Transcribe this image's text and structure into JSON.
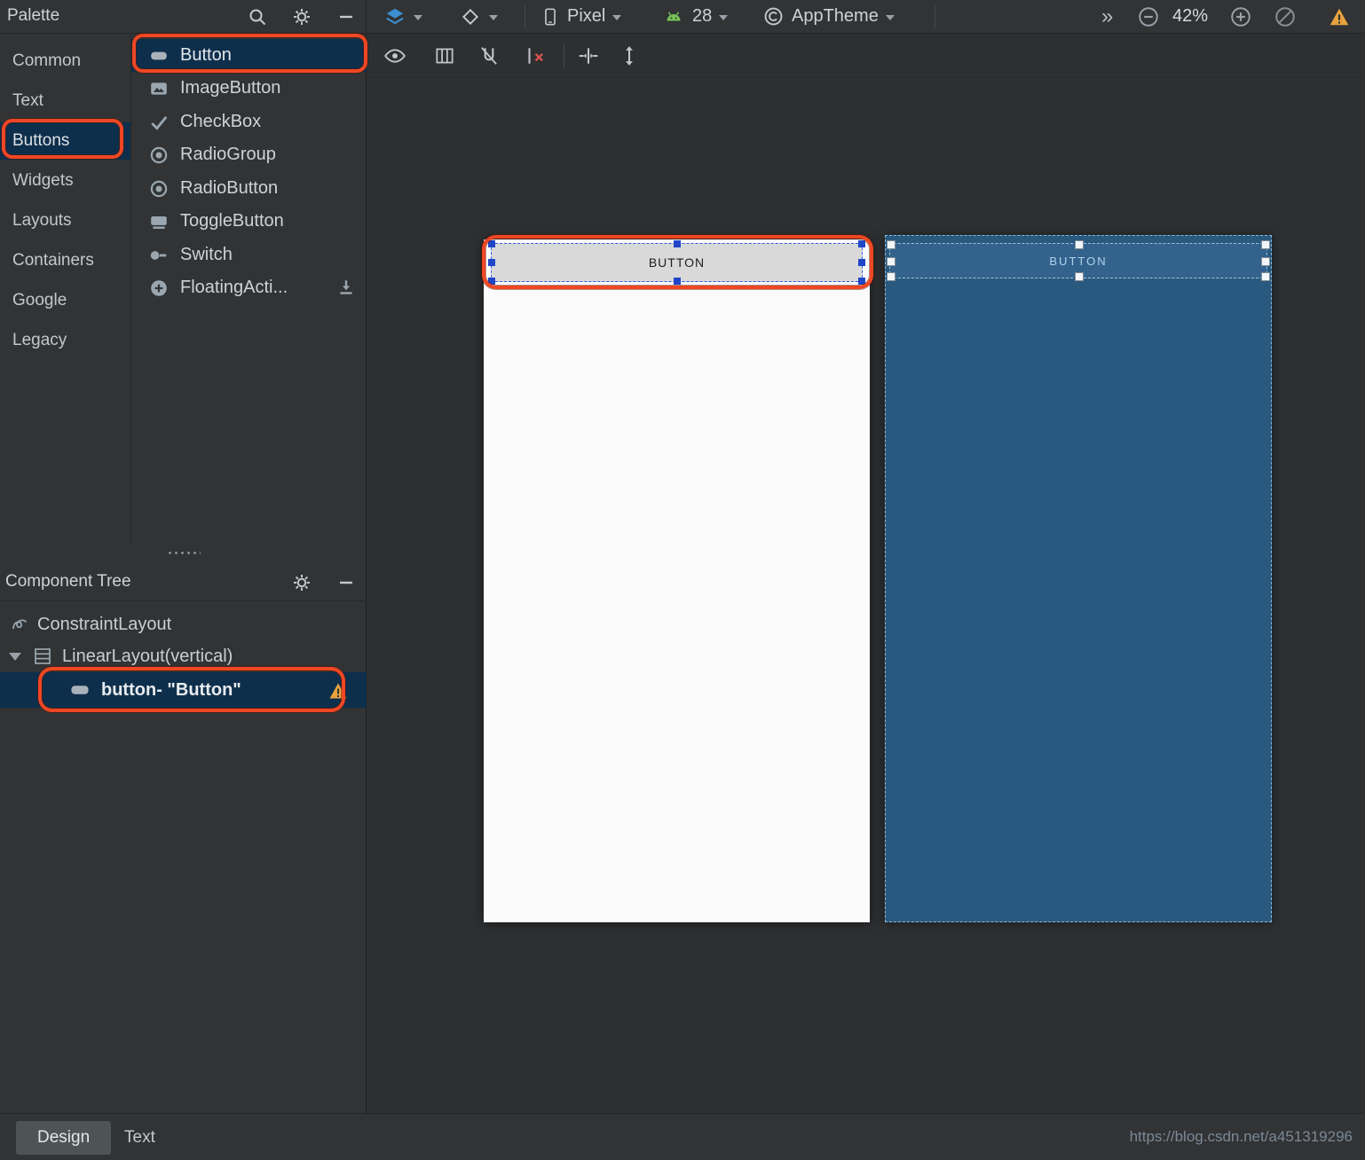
{
  "colors": {
    "annotation_red": "#ee4723",
    "selection_blue": "#0e2f4c",
    "blueprint_blue": "#2a597f",
    "warning_orange": "#e8a33d",
    "android_green": "#78c257"
  },
  "palette": {
    "title": "Palette",
    "categories": [
      {
        "label": "Common",
        "selected": false
      },
      {
        "label": "Text",
        "selected": false
      },
      {
        "label": "Buttons",
        "selected": true
      },
      {
        "label": "Widgets",
        "selected": false
      },
      {
        "label": "Layouts",
        "selected": false
      },
      {
        "label": "Containers",
        "selected": false
      },
      {
        "label": "Google",
        "selected": false
      },
      {
        "label": "Legacy",
        "selected": false
      }
    ],
    "items": [
      {
        "label": "Button",
        "selected": true
      },
      {
        "label": "ImageButton",
        "selected": false
      },
      {
        "label": "CheckBox",
        "selected": false
      },
      {
        "label": "RadioGroup",
        "selected": false
      },
      {
        "label": "RadioButton",
        "selected": false
      },
      {
        "label": "ToggleButton",
        "selected": false
      },
      {
        "label": "Switch",
        "selected": false
      },
      {
        "label": "FloatingActi...",
        "selected": false,
        "downloadable": true
      }
    ]
  },
  "design_toolbar": {
    "device": "Pixel",
    "api": "28",
    "theme": "AppTheme",
    "zoom": "42%",
    "overflow_chevrons": "»"
  },
  "component_tree": {
    "title": "Component Tree",
    "nodes": [
      {
        "label": "ConstraintLayout",
        "selected": false
      },
      {
        "label": "LinearLayout(vertical)",
        "selected": false,
        "expanded": true
      },
      {
        "label": "button- \"Button\"",
        "selected": true,
        "warning": true
      }
    ]
  },
  "canvas": {
    "design_button_label": "BUTTON",
    "blueprint_button_label": "BUTTON"
  },
  "footer": {
    "tabs": [
      "Design",
      "Text"
    ],
    "active_tab": "Design",
    "watermark": "https://blog.csdn.net/a451319296"
  }
}
